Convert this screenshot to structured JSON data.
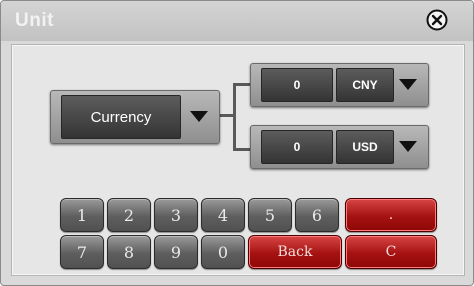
{
  "window": {
    "title": "Unit"
  },
  "unit_selector": {
    "value": "Currency"
  },
  "conversion_top": {
    "amount": "0",
    "currency": "CNY"
  },
  "conversion_bottom": {
    "amount": "0",
    "currency": "USD"
  },
  "keypad": {
    "row1": [
      "1",
      "2",
      "3",
      "4",
      "5",
      "6",
      "."
    ],
    "row2": [
      "7",
      "8",
      "9",
      "0",
      "Back",
      "C"
    ]
  },
  "colors": {
    "key_gray": "#5e5e5e",
    "key_red": "#a51212",
    "window_bg": "#d9d9d9"
  },
  "icons": {
    "close": "close-circle-icon",
    "dropdown": "triangle-down-icon"
  }
}
